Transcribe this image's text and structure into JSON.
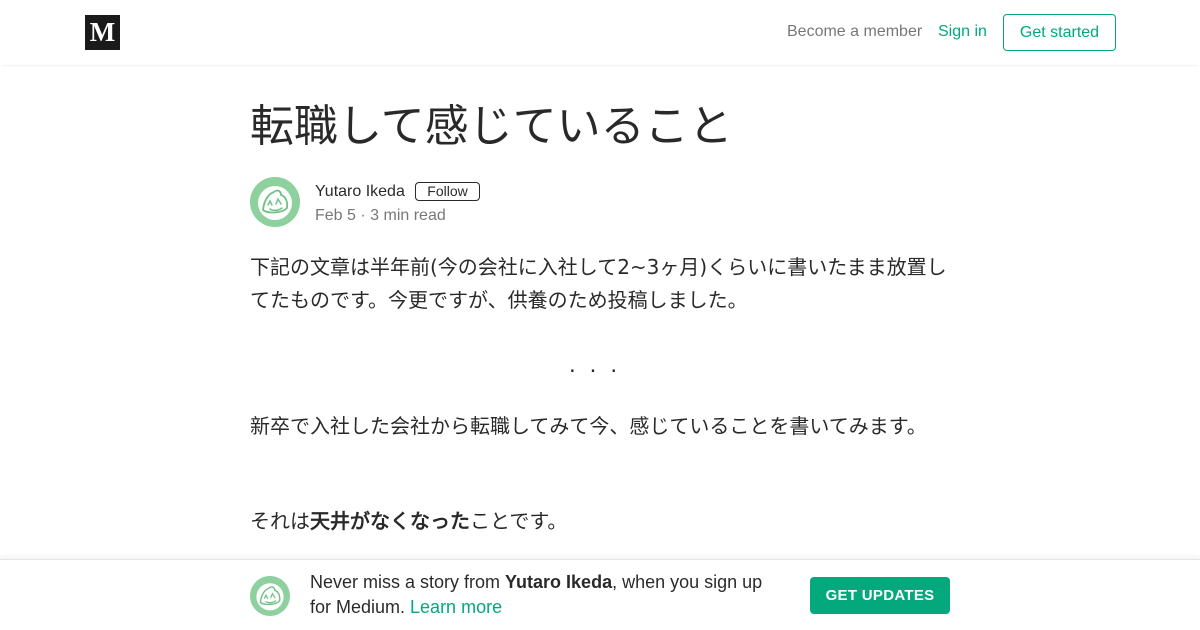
{
  "header": {
    "logo": "M",
    "become_member": "Become a member",
    "sign_in": "Sign in",
    "get_started": "Get started"
  },
  "article": {
    "title": "転職して感じていること",
    "author": {
      "name": "Yutaro Ikeda",
      "follow_label": "Follow",
      "date": "Feb 5",
      "read_time": "3 min read",
      "meta_separator": " · "
    },
    "paragraph1": "下記の文章は半年前(今の会社に入社して2~3ヶ月)くらいに書いたまま放置してたものです。今更ですが、供養のため投稿しました。",
    "separator": "...",
    "paragraph2": "新卒で入社した会社から転職してみて今、感じていることを書いてみます。",
    "paragraph3": {
      "before": "それは",
      "bold": "天井がなくなった",
      "after": "ことです。"
    }
  },
  "banner": {
    "text_prefix": "Never miss a story from ",
    "author": "Yutaro Ikeda",
    "text_suffix": ", when you sign up for Medium. ",
    "learn_more": "Learn more",
    "button": "GET UPDATES"
  },
  "colors": {
    "accent": "#03a87c",
    "avatar_bg": "#8fd19e"
  },
  "icons": {
    "logo": "medium-logo-icon",
    "avatar": "author-avatar-illustration"
  }
}
